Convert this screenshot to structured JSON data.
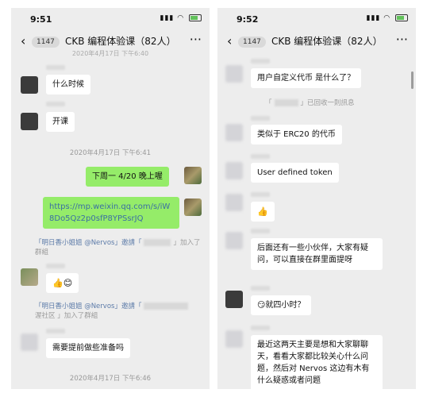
{
  "left": {
    "time": "9:51",
    "header": {
      "count": "1147",
      "title": "CKB 编程体验课（82人）"
    },
    "top_cut_time": "2020年4月17日 下午6:40",
    "messages": [
      {
        "text": "什么时候"
      },
      {
        "text": "开课"
      },
      {
        "timestamp": "2020年4月17日 下午6:41"
      },
      {
        "text": "下周一 4/20 晚上喔"
      },
      {
        "text": "https://mp.weixin.qq.com/s/iW8Do5Qz2p0sfP8YPSsrJQ"
      },
      {
        "sys_a": "「明日香小姐姐 @Nervos」邀請「",
        "sys_b": "」加入了群組"
      },
      {
        "text": "👍😊"
      },
      {
        "sys_a": "「明日香小姐姐 @Nervos」邀請「",
        "sys_b": "」加入了群組",
        "sys_extra": "渥社区"
      },
      {
        "text": "需要提前做些准备吗"
      },
      {
        "timestamp": "2020年4月17日 下午6:46"
      }
    ]
  },
  "right": {
    "time": "9:52",
    "header": {
      "count": "1147",
      "title": "CKB 编程体验课（82人）"
    },
    "messages": [
      {
        "text": "用户自定义代币 是什么了？"
      },
      {
        "sys_a": "「",
        "sys_b": "」已回收一則訊息"
      },
      {
        "text": "类似于 ERC20 的代币"
      },
      {
        "text": "User defined token"
      },
      {
        "text": "👍"
      },
      {
        "text": "后面还有一些小伙伴，大家有疑问，可以直接在群里面提呀"
      },
      {
        "text": "😏就四小时？"
      },
      {
        "text": "最近这两天主要是想和大家聊聊天，看看大家都比较关心什么问题，然后对 Nervos 这边有木有什么疑惑或者问题"
      }
    ]
  }
}
